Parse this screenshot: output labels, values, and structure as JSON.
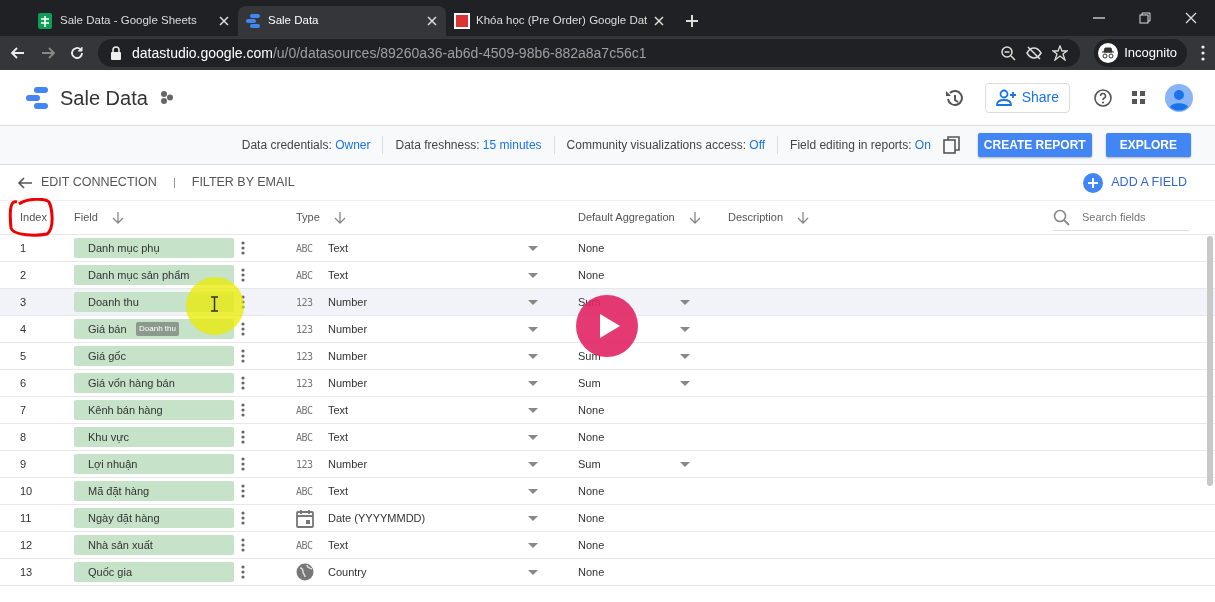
{
  "browser": {
    "tabs": [
      {
        "title": "Sale Data - Google Sheets",
        "selected": false,
        "kind": "sheets"
      },
      {
        "title": "Sale Data",
        "selected": true,
        "kind": "studio"
      },
      {
        "title": "Khóa học (Pre Order) Google Dat",
        "selected": false,
        "kind": "course"
      }
    ],
    "url_host": "datastudio.google.com",
    "url_path": "/u/0/datasources/89260a36-ab6d-4509-98b6-882a8a7c56c1",
    "profile": "Incognito"
  },
  "app": {
    "title": "Sale Data",
    "share": "Share"
  },
  "info": [
    {
      "label": "Data credentials:",
      "value": "Owner"
    },
    {
      "label": "Data freshness:",
      "value": "15 minutes"
    },
    {
      "label": "Community visualizations access:",
      "value": "Off"
    },
    {
      "label": "Field editing in reports:",
      "value": "On"
    }
  ],
  "buttons": [
    "CREATE REPORT",
    "EXPLORE"
  ],
  "toolbar": {
    "back": "EDIT CONNECTION",
    "filter": "FILTER BY EMAIL",
    "add": "ADD A FIELD",
    "search_placeholder": "Search fields"
  },
  "table": {
    "columns": [
      {
        "label": "Index",
        "sortable": false
      },
      {
        "label": "Field",
        "sortable": true
      },
      {
        "label": "Type",
        "sortable": true
      },
      {
        "label": "Default Aggregation",
        "sortable": true
      },
      {
        "label": "Description",
        "sortable": true
      }
    ],
    "rows": [
      {
        "index": "1",
        "field": "Danh mục phụ",
        "kind": "text",
        "type_badge": "ABC",
        "type": "Text",
        "aggregation": "None",
        "aggregation_menu": false,
        "hovered": false
      },
      {
        "index": "2",
        "field": "Danh mục sản phẩm",
        "kind": "text",
        "type_badge": "ABC",
        "type": "Text",
        "aggregation": "None",
        "aggregation_menu": false,
        "hovered": false
      },
      {
        "index": "3",
        "field": "Doanh thu",
        "kind": "number",
        "type_badge": "123",
        "type": "Number",
        "aggregation": "Sum",
        "aggregation_menu": true,
        "hovered": true
      },
      {
        "index": "4",
        "field": "Giá bán",
        "kind": "number",
        "type_badge": "123",
        "type": "Number",
        "aggregation_menu": true,
        "hovered": false,
        "drag_label": "Doanh thu"
      },
      {
        "index": "5",
        "field": "Giá gốc",
        "kind": "number",
        "type_badge": "123",
        "type": "Number",
        "aggregation": "Sum",
        "aggregation_menu": true,
        "hovered": false
      },
      {
        "index": "6",
        "field": "Giá vốn hàng bán",
        "kind": "number",
        "type_badge": "123",
        "type": "Number",
        "aggregation": "Sum",
        "aggregation_menu": true,
        "hovered": false
      },
      {
        "index": "7",
        "field": "Kênh bán hàng",
        "kind": "text",
        "type_badge": "ABC",
        "type": "Text",
        "aggregation": "None",
        "aggregation_menu": false,
        "hovered": false
      },
      {
        "index": "8",
        "field": "Khu vực",
        "kind": "text",
        "type_badge": "ABC",
        "type": "Text",
        "aggregation": "None",
        "aggregation_menu": false,
        "hovered": false
      },
      {
        "index": "9",
        "field": "Lợi nhuận",
        "kind": "number",
        "type_badge": "123",
        "type": "Number",
        "aggregation": "Sum",
        "aggregation_menu": true,
        "hovered": false
      },
      {
        "index": "10",
        "field": "Mã đặt hàng",
        "kind": "text",
        "type_badge": "ABC",
        "type": "Text",
        "aggregation": "None",
        "aggregation_menu": false,
        "hovered": false
      },
      {
        "index": "11",
        "field": "Ngày đặt hàng",
        "kind": "date",
        "type": "Date (YYYYMMDD)",
        "aggregation": "None",
        "aggregation_menu": false,
        "hovered": false
      },
      {
        "index": "12",
        "field": "Nhà sản xuất",
        "kind": "text",
        "type_badge": "ABC",
        "type": "Text",
        "aggregation": "None",
        "aggregation_menu": false,
        "hovered": false
      },
      {
        "index": "13",
        "field": "Quốc gia",
        "kind": "geo",
        "type": "Country",
        "aggregation": "None",
        "aggregation_menu": false,
        "hovered": false
      }
    ]
  }
}
